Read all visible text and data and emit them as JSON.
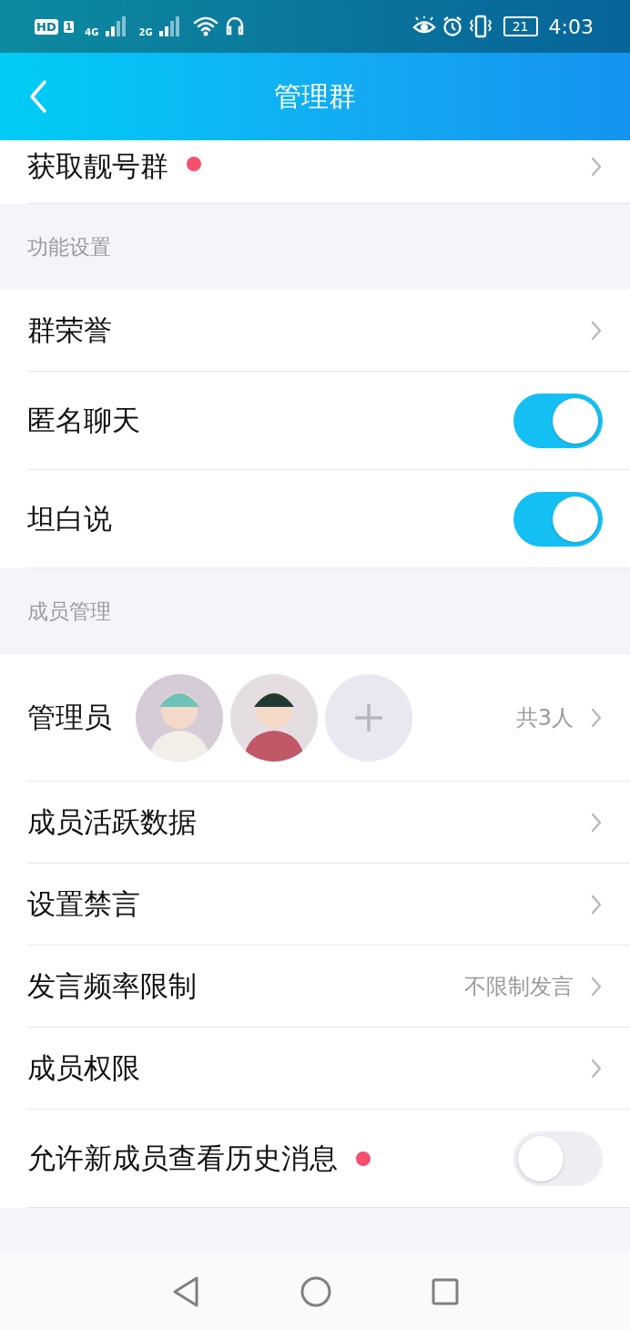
{
  "status_bar": {
    "left_labels": [
      "HD",
      "1",
      "4G",
      "2G"
    ],
    "battery": "21",
    "time": "4:03"
  },
  "header": {
    "title": "管理群"
  },
  "sections": [
    {
      "rows": [
        {
          "kind": "link",
          "label": "获取靓号群",
          "dot": true
        }
      ]
    },
    {
      "title": "功能设置",
      "rows": [
        {
          "kind": "link",
          "label": "群荣誉",
          "dot": false
        },
        {
          "kind": "toggle",
          "label": "匿名聊天",
          "dot": false,
          "on": true
        },
        {
          "kind": "toggle",
          "label": "坦白说",
          "dot": false,
          "on": true
        }
      ]
    },
    {
      "title": "成员管理",
      "rows": [
        {
          "kind": "admins",
          "label": "管理员",
          "dot": false,
          "value": "共3人"
        },
        {
          "kind": "link",
          "label": "成员活跃数据",
          "dot": false
        },
        {
          "kind": "link",
          "label": "设置禁言",
          "dot": false
        },
        {
          "kind": "link",
          "label": "发言频率限制",
          "dot": false,
          "value": "不限制发言"
        },
        {
          "kind": "link",
          "label": "成员权限",
          "dot": false
        },
        {
          "kind": "toggle",
          "label": "允许新成员查看历史消息",
          "dot": true,
          "on": false
        }
      ]
    }
  ]
}
